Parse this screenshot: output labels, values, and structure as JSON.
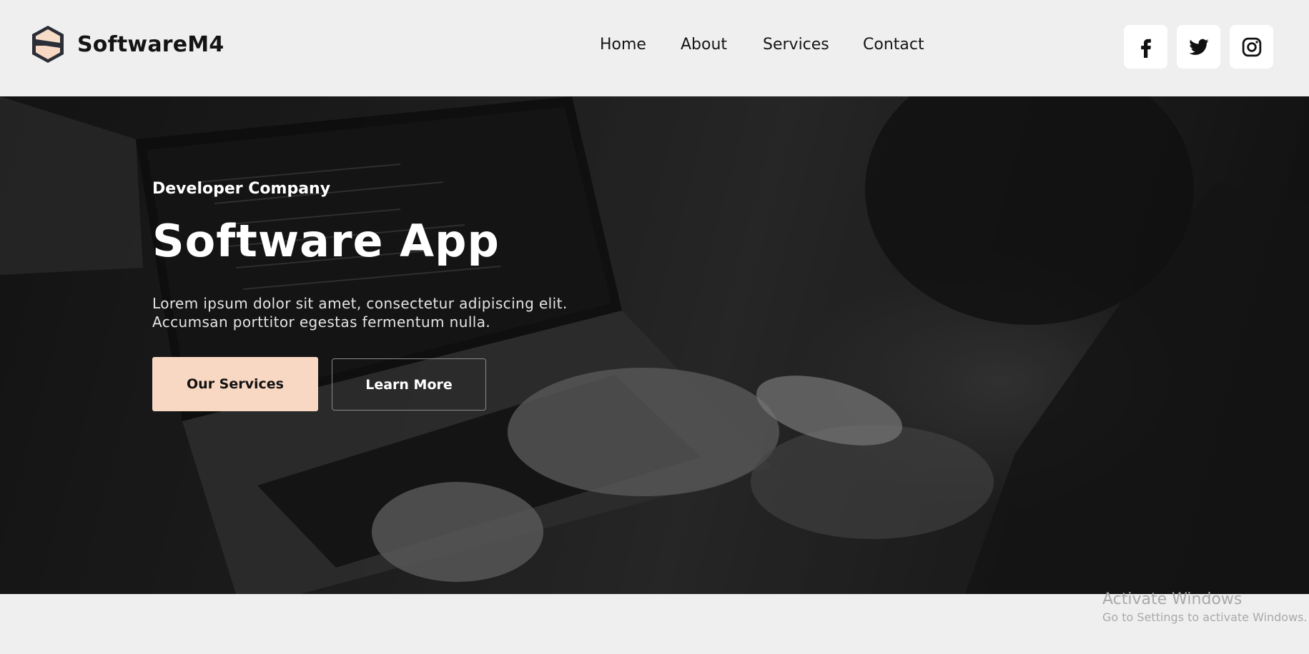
{
  "brand": {
    "name": "SoftwareM4",
    "logo_icon": "hexagon-s-logo",
    "logo_colors": {
      "outline": "#2b2e37",
      "fill_top": "#f5ddc8",
      "fill_bottom": "#f9d8c3",
      "stripe": "#2b2e37"
    }
  },
  "nav": {
    "items": [
      {
        "label": "Home"
      },
      {
        "label": "About"
      },
      {
        "label": "Services"
      },
      {
        "label": "Contact"
      }
    ]
  },
  "social": [
    {
      "icon": "facebook-icon",
      "glyph": "f"
    },
    {
      "icon": "twitter-icon"
    },
    {
      "icon": "instagram-icon"
    }
  ],
  "hero": {
    "eyebrow": "Developer Company",
    "title": "Software App",
    "description_line1": "Lorem ipsum dolor sit amet, consectetur adipiscing elit.",
    "description_line2": "Accumsan porttitor egestas fermentum nulla.",
    "primary_button": "Our Services",
    "secondary_button": "Learn More",
    "background_image": "person typing on a laptop (dark overlay)"
  },
  "os_watermark": {
    "title": "Activate Windows",
    "subtitle": "Go to Settings to activate Windows."
  },
  "colors": {
    "page_bg": "#efefef",
    "accent": "#f9d8c3",
    "text_dark": "#141414",
    "text_light": "#ffffff"
  }
}
